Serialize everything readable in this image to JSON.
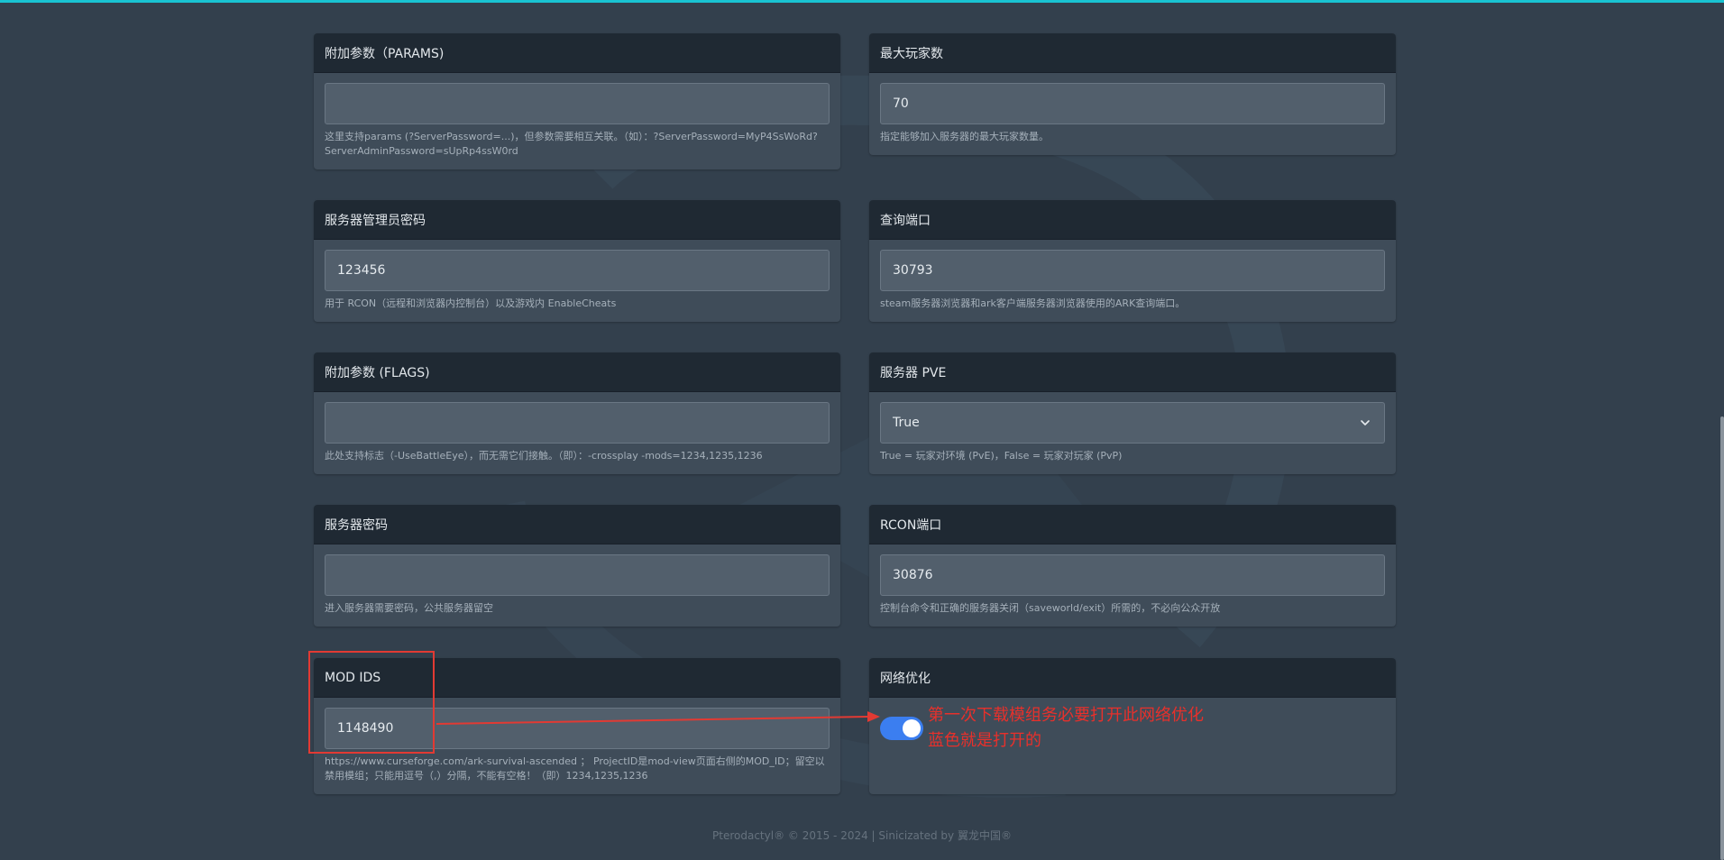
{
  "cards": {
    "params": {
      "title": "附加参数（PARAMS)",
      "value": "",
      "help": "这里支持params (?ServerPassword=...)，但参数需要相互关联。（如）：?ServerPassword=MyP4SsWoRd?ServerAdminPassword=sUpRp4ssW0rd"
    },
    "max_players": {
      "title": "最大玩家数",
      "value": "70",
      "help": "指定能够加入服务器的最大玩家数量。"
    },
    "admin_password": {
      "title": "服务器管理员密码",
      "value": "123456",
      "help": "用于 RCON（远程和浏览器内控制台）以及游戏内 EnableCheats"
    },
    "query_port": {
      "title": "查询端口",
      "value": "30793",
      "help": "steam服务器浏览器和ark客户端服务器浏览器使用的ARK查询端口。"
    },
    "flags": {
      "title": "附加参数 (FLAGS)",
      "value": "",
      "help": "此处支持标志（-UseBattleEye），而无需它们接触。（即）：-crossplay -mods=1234,1235,1236"
    },
    "pve": {
      "title": "服务器 PVE",
      "value": "True",
      "help": "True = 玩家对环境 (PvE)，False = 玩家对玩家 (PvP)"
    },
    "server_password": {
      "title": "服务器密码",
      "value": "",
      "help": "进入服务器需要密码，公共服务器留空"
    },
    "rcon_port": {
      "title": "RCON端口",
      "value": "30876",
      "help": "控制台命令和正确的服务器关闭（saveworld/exit）所需的，不必向公众开放"
    },
    "mod_ids": {
      "title": "MOD IDS",
      "value": "1148490",
      "help": "https://www.curseforge.com/ark-survival-ascended ； ProjectID是mod-view页面右侧的MOD_ID；留空以禁用模组；只能用逗号（,）分隔，不能有空格！（即）1234,1235,1236"
    },
    "network_opt": {
      "title": "网络优化",
      "toggle_on": true
    }
  },
  "annotation": {
    "line1": "第一次下载模组务必要打开此网络优化",
    "line2": "蓝色就是打开的",
    "color": "#e8302b"
  },
  "footer": {
    "text": "Pterodactyl® © 2015 - 2024 | Sinicizated by 翼龙中国®"
  },
  "colors": {
    "background": "#33404d",
    "card": "#3f4c59",
    "card_header": "#1f2933",
    "input": "#525f6c",
    "accent_top": "#19c3d2",
    "toggle_on": "#3b7ef0"
  },
  "icons": {
    "select_indicator": "chevron-down-icon"
  }
}
